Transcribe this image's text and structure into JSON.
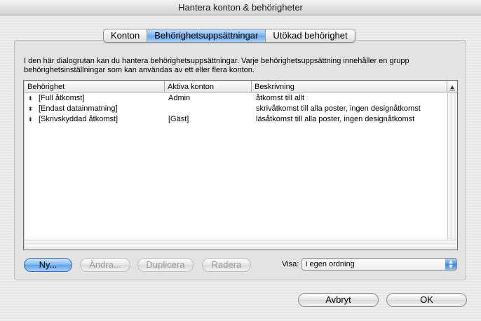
{
  "window": {
    "title": "Hantera konton & behörigheter"
  },
  "tabs": [
    {
      "label": "Konton",
      "active": false
    },
    {
      "label": "Behörighetsuppsättningar",
      "active": true
    },
    {
      "label": "Utökad behörighet",
      "active": false
    }
  ],
  "description": "I den här dialogrutan kan du hantera behörighetsuppsättningar.  Varje behörighetsuppsättning innehåller en grupp behörighetsinställningar som kan användas av ett eller flera konton.",
  "table": {
    "headers": {
      "permission": "Behörighet",
      "accounts": "Aktiva konton",
      "description": "Beskrivning"
    },
    "sort_icon": "sort-icon",
    "rows": [
      {
        "permission": "[Full åtkomst]",
        "accounts": "Admin",
        "description": "åtkomst till allt"
      },
      {
        "permission": "[Endast datainmatning]",
        "accounts": "",
        "description": "skrivåtkomst till alla poster, ingen designåtkomst"
      },
      {
        "permission": "[Skrivskyddad åtkomst]",
        "accounts": "[Gäst]",
        "description": "läsåtkomst till alla poster, ingen designåtkomst"
      }
    ]
  },
  "buttons": {
    "new": "Ny...",
    "edit": "Ändra...",
    "duplicate": "Duplicera",
    "delete": "Radera",
    "cancel": "Avbryt",
    "ok": "OK"
  },
  "show": {
    "label": "Visa:",
    "selected": "i egen ordning"
  },
  "colors": {
    "accent": "#6aa7ea",
    "default_button": "#5d9fe8"
  }
}
